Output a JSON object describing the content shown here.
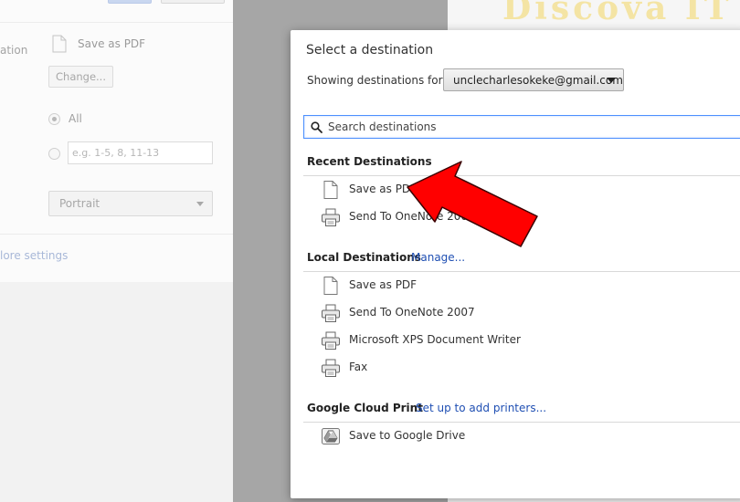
{
  "watermark": {
    "text": "Discova IT"
  },
  "background_panel": {
    "destination_label": "ation",
    "destination_name": "Save as PDF",
    "change_button": "Change...",
    "pages_all_label": "All",
    "pages_placeholder": "e.g. 1-5, 8, 11-13",
    "layout_value": "Portrait",
    "more_settings_link": "lore settings"
  },
  "dialog": {
    "title": "Select a destination",
    "showing_label": "Showing destinations for",
    "account": "unclecharlesokeke@gmail.com",
    "search_placeholder": "Search destinations",
    "recent": {
      "heading": "Recent Destinations",
      "items": [
        {
          "label": "Save as PDF",
          "icon": "document-icon"
        },
        {
          "label": "Send To OneNote 2007",
          "icon": "printer-icon"
        }
      ]
    },
    "local": {
      "heading": "Local Destinations",
      "manage_link": "Manage...",
      "items": [
        {
          "label": "Save as PDF",
          "icon": "document-icon"
        },
        {
          "label": "Send To OneNote 2007",
          "icon": "printer-icon"
        },
        {
          "label": "Microsoft XPS Document Writer",
          "icon": "printer-icon"
        },
        {
          "label": "Fax",
          "icon": "printer-icon"
        }
      ]
    },
    "cloud": {
      "heading": "Google Cloud Print",
      "setup_link": "Set up to add printers...",
      "items": [
        {
          "label": "Save to Google Drive",
          "icon": "google-drive-icon"
        }
      ]
    }
  },
  "colors": {
    "link": "#1f4fb3",
    "search_focus": "#4d90fe",
    "annotation_arrow": "#ff0000"
  }
}
